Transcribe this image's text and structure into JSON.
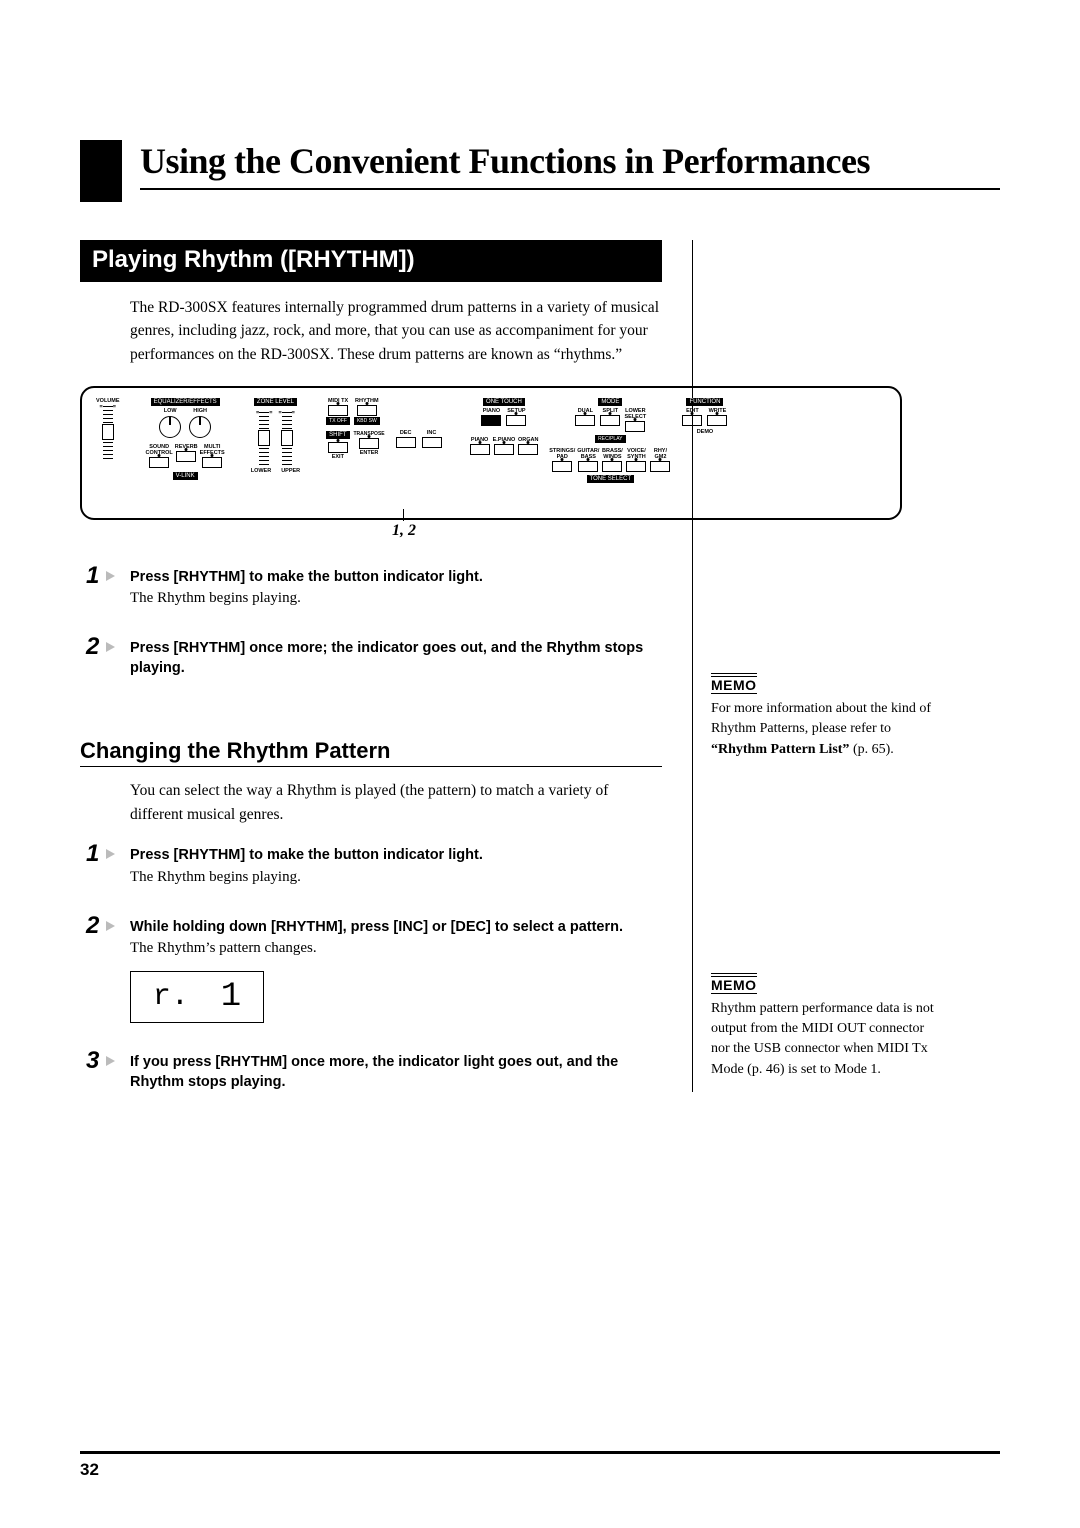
{
  "chapter_title": "Using the Convenient Functions in Performances",
  "section1_title": "Playing Rhythm ([RHYTHM])",
  "intro": "The RD-300SX features internally programmed drum patterns in a variety of musical genres, including jazz, rock, and more, that you can use as accompaniment for your performances on the RD-300SX. These drum patterns are known as “rhythms.”",
  "callout_label": "1, 2",
  "section1_steps": [
    {
      "num": "1",
      "head": "Press [RHYTHM] to make the button indicator light.",
      "body": "The Rhythm begins playing."
    },
    {
      "num": "2",
      "head": "Press [RHYTHM] once more; the indicator goes out, and the Rhythm stops playing.",
      "body": ""
    }
  ],
  "section2_title": "Changing the Rhythm Pattern",
  "section2_intro": "You can select the way a Rhythm is played (the pattern) to match a variety of different musical genres.",
  "section2_steps": [
    {
      "num": "1",
      "head": "Press [RHYTHM] to make the button indicator light.",
      "body": "The Rhythm begins playing."
    },
    {
      "num": "2",
      "head": "While holding down [RHYTHM], press [INC] or [DEC] to select a pattern.",
      "body": "The Rhythm’s pattern changes."
    },
    {
      "num": "3",
      "head": "If you press [RHYTHM] once more, the indicator light goes out, and the Rhythm stops playing.",
      "body": ""
    }
  ],
  "memo_label": "MEMO",
  "memo1_text_a": "For more information about the kind of Rhythm Patterns, please refer to ",
  "memo1_text_b": "“Rhythm Pattern List”",
  "memo1_text_c": " (p. 65).",
  "memo2_text": "Rhythm pattern performance data is not output from the MIDI OUT connector nor the USB connector when MIDI Tx Mode (p. 46) is set to Mode 1.",
  "lcd_value": "r.",
  "lcd_value2": "1",
  "page_number": "32",
  "panel": {
    "volume": "VOLUME",
    "eq": "EQUALIZER/EFFECTS",
    "low": "LOW",
    "high": "HIGH",
    "sound_ctrl": "SOUND\nCONTROL",
    "reverb": "REVERB",
    "multi_fx": "MULTI\nEFFECTS",
    "v_link": "V-LINK",
    "zone": "ZONE LEVEL",
    "lower": "LOWER",
    "upper": "UPPER",
    "miditx": "MIDI TX",
    "rhythm": "RHYTHM",
    "tx_off": "TX OFF",
    "kbd_sw": "KBD SW",
    "shift": "SHIFT",
    "transpose": "TRANSPOSE",
    "exit": "EXIT",
    "enter": "ENTER",
    "dec": "DEC",
    "inc": "INC",
    "one_touch": "ONE TOUCH",
    "piano": "PIANO",
    "setup": "SETUP",
    "mode": "MODE",
    "dual": "DUAL",
    "split": "SPLIT",
    "lower_select": "LOWER\nSELECT",
    "rec_play": "REC/PLAY",
    "function": "FUNCTION",
    "edit": "EDIT",
    "write": "WRITE",
    "demo": "DEMO",
    "epiano": "E.PIANO",
    "organ": "ORGAN",
    "strings_pad": "STRINGS/\nPAD",
    "guitar_bass": "GUITAR/\nBASS",
    "brass_winds": "BRASS/\nWINDS",
    "voice_synth": "VOICE/\nSYNTH",
    "rhy_gm2": "RHY/\nGM2",
    "tone_select": "TONE SELECT"
  }
}
